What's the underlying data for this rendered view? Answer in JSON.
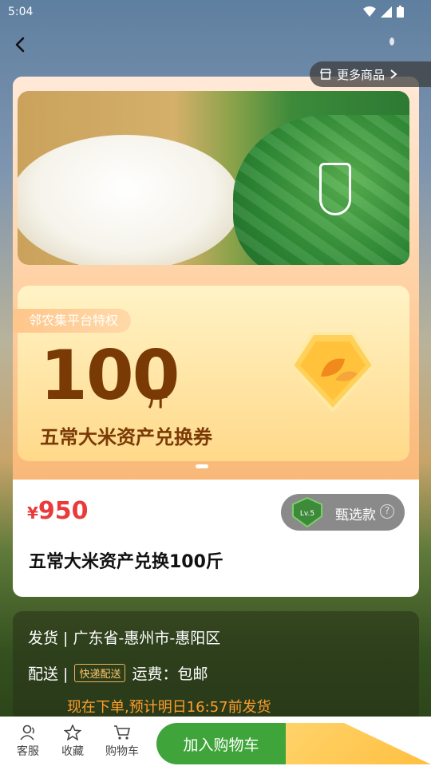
{
  "status_bar": {
    "time": "5:04"
  },
  "banner": {
    "more_goods_label": "更多商品",
    "badge": "邻农集平台特权",
    "amount": "100",
    "unit": "斤",
    "desc": "五常大米资产兑换券"
  },
  "product": {
    "currency": "¥",
    "price": "950",
    "select_label": "甄选款",
    "level": "Lv.5",
    "title": "五常大米资产兑换100斤"
  },
  "shipping": {
    "ship_from": "发货 | 广东省-惠州市-惠阳区",
    "deliver_label": "配送 |",
    "deliver_tag": "快递配送",
    "fee": "运费：包邮",
    "eta": "现在下单,预计明日16:57前发货"
  },
  "bottom_bar": {
    "service": "客服",
    "favorite": "收藏",
    "cart": "购物车",
    "add_to_cart": "加入购物车"
  },
  "colors": {
    "price": "#e93b3b",
    "primary_button": "#3fa43a",
    "buy_button": "#ffc24c"
  }
}
